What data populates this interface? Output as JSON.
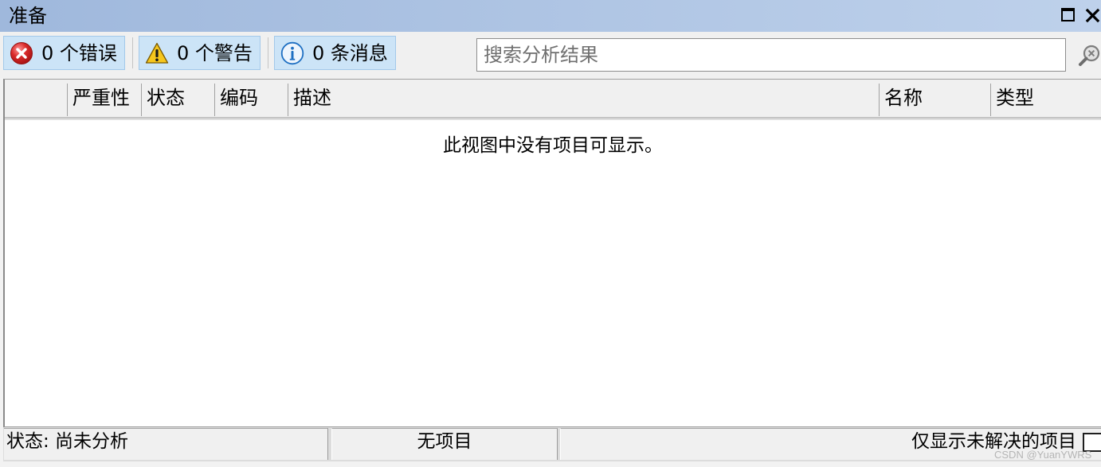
{
  "window": {
    "title": "准备",
    "maximize_icon": "maximize-icon",
    "close_icon": "close-icon"
  },
  "colors": {
    "title_bar_start": "#9fb8dc",
    "title_bar_end": "#bed1eb",
    "toggle_active_bg": "#cce4f7",
    "toggle_active_border": "#a3c9ea",
    "error_red": "#d92a2a",
    "warning_yellow": "#f6c61d",
    "info_blue": "#1e6fc2"
  },
  "toolbar": {
    "filters": [
      {
        "label": "0 个错误",
        "icon": "error-icon",
        "selected": true
      },
      {
        "label": "0 个警告",
        "icon": "warning-icon",
        "selected": true
      },
      {
        "label": "0 条消息",
        "icon": "info-icon",
        "selected": true
      }
    ],
    "search": {
      "value": "",
      "placeholder": "搜索分析结果",
      "icon": "search-clear-icon"
    }
  },
  "table": {
    "columns": [
      "严重性",
      "状态",
      "编码",
      "描述",
      "名称",
      "类型"
    ],
    "rows": [],
    "empty_message": "此视图中没有项目可显示。"
  },
  "status_bar": {
    "analysis_status": "状态: 尚未分析",
    "item_count": "无项目",
    "unresolved_only_label": "仅显示未解决的项目",
    "unresolved_only_checked": false
  },
  "watermark": "CSDN @YuanYWRS"
}
